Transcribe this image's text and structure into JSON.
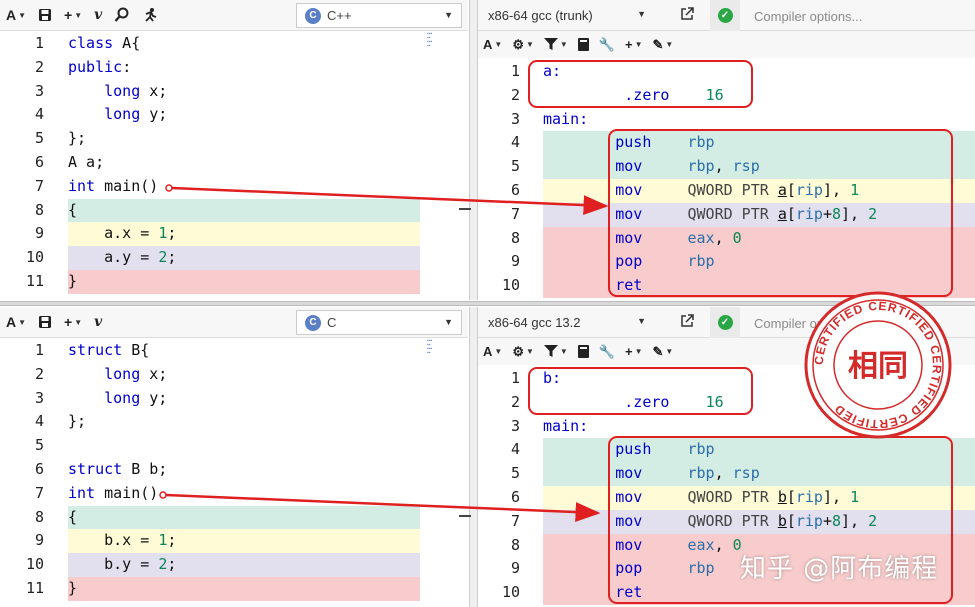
{
  "colors": {
    "teal_highlight": "#d3ede4",
    "yellow_highlight": "#fefbd6",
    "lavender_highlight": "#e2e0ef",
    "pink_highlight": "#f8cccc",
    "annotation_red": "#e02020"
  },
  "editor_toolbar": {
    "font_label": "A",
    "add_label": "+",
    "vim_label": "v",
    "icons": [
      "font-size-icon",
      "save-icon",
      "add-icon",
      "vim-icon",
      "search-icon",
      "run-icon"
    ]
  },
  "panels": [
    {
      "language": "C++",
      "language_logo": "C",
      "compiler": "x86-64 gcc (trunk)",
      "compiler_options_placeholder": "Compiler options...",
      "source_lines": [
        {
          "n": "1",
          "code": "class A{"
        },
        {
          "n": "2",
          "code": "public:"
        },
        {
          "n": "3",
          "code": "    long x;"
        },
        {
          "n": "4",
          "code": "    long y;"
        },
        {
          "n": "5",
          "code": "};"
        },
        {
          "n": "6",
          "code": "A a;"
        },
        {
          "n": "7",
          "code": "int main()"
        },
        {
          "n": "8",
          "code": "{"
        },
        {
          "n": "9",
          "code": "    a.x = 1;"
        },
        {
          "n": "10",
          "code": "    a.y = 2;"
        },
        {
          "n": "11",
          "code": "}"
        }
      ],
      "asm_lines": [
        {
          "n": "1",
          "label": "a:"
        },
        {
          "n": "2",
          "instr": ".zero",
          "operands": "16"
        },
        {
          "n": "3",
          "label": "main:"
        },
        {
          "n": "4",
          "instr": "push",
          "operands": "rbp"
        },
        {
          "n": "5",
          "instr": "mov",
          "operands": "rbp, rsp"
        },
        {
          "n": "6",
          "instr": "mov",
          "operands": "QWORD PTR a[rip], 1"
        },
        {
          "n": "7",
          "instr": "mov",
          "operands": "QWORD PTR a[rip+8], 2"
        },
        {
          "n": "8",
          "instr": "mov",
          "operands": "eax, 0"
        },
        {
          "n": "9",
          "instr": "pop",
          "operands": "rbp"
        },
        {
          "n": "10",
          "instr": "ret",
          "operands": ""
        }
      ]
    },
    {
      "language": "C",
      "language_logo": "C",
      "compiler": "x86-64 gcc 13.2",
      "compiler_options_placeholder": "Compiler options...",
      "source_lines": [
        {
          "n": "1",
          "code": "struct B{"
        },
        {
          "n": "2",
          "code": "    long x;"
        },
        {
          "n": "3",
          "code": "    long y;"
        },
        {
          "n": "4",
          "code": "};"
        },
        {
          "n": "5",
          "code": ""
        },
        {
          "n": "6",
          "code": "struct B b;"
        },
        {
          "n": "7",
          "code": "int main()"
        },
        {
          "n": "8",
          "code": "{"
        },
        {
          "n": "9",
          "code": "    b.x = 1;"
        },
        {
          "n": "10",
          "code": "    b.y = 2;"
        },
        {
          "n": "11",
          "code": "}"
        }
      ],
      "asm_lines": [
        {
          "n": "1",
          "label": "b:"
        },
        {
          "n": "2",
          "instr": ".zero",
          "operands": "16"
        },
        {
          "n": "3",
          "label": "main:"
        },
        {
          "n": "4",
          "instr": "push",
          "operands": "rbp"
        },
        {
          "n": "5",
          "instr": "mov",
          "operands": "rbp, rsp"
        },
        {
          "n": "6",
          "instr": "mov",
          "operands": "QWORD PTR b[rip], 1"
        },
        {
          "n": "7",
          "instr": "mov",
          "operands": "QWORD PTR b[rip+8], 2"
        },
        {
          "n": "8",
          "instr": "mov",
          "operands": "eax, 0"
        },
        {
          "n": "9",
          "instr": "pop",
          "operands": "rbp"
        },
        {
          "n": "10",
          "instr": "ret",
          "operands": ""
        }
      ]
    }
  ],
  "stamp": {
    "ring_text": "CERTIFIED CERTIFIED CERTIFIED CERTIFIED",
    "center_text": "相同"
  },
  "watermark": "知乎 @阿布编程"
}
